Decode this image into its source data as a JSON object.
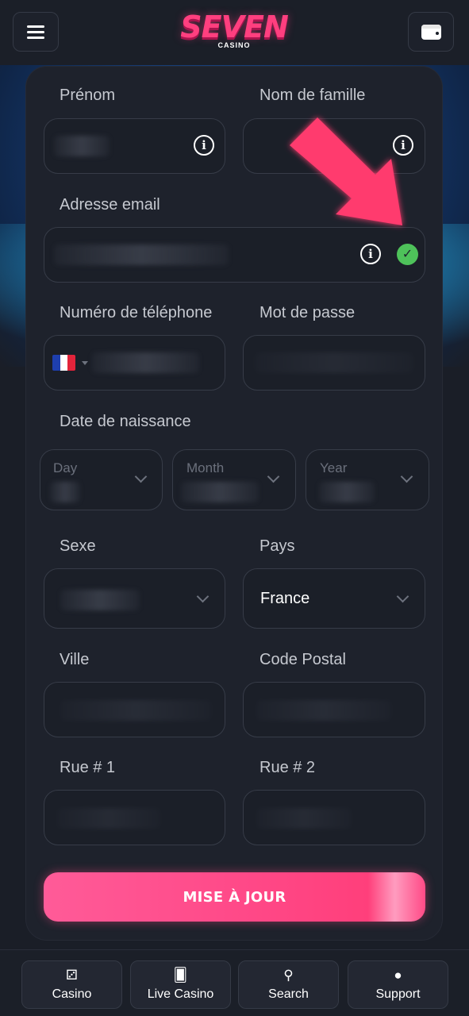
{
  "header": {
    "logo_text": "SEVEN",
    "logo_sub": "CASINO",
    "menu_icon": "hamburger-menu-icon",
    "wallet_icon": "wallet-icon"
  },
  "form": {
    "first_name": {
      "label": "Prénom",
      "icon": "info-icon"
    },
    "last_name": {
      "label": "Nom de famille",
      "icon": "info-icon"
    },
    "email": {
      "label": "Adresse email",
      "icon": "info-icon",
      "status_icon": "check-circle-icon"
    },
    "phone": {
      "label": "Numéro de téléphone",
      "country_flag": "france-flag-icon"
    },
    "password": {
      "label": "Mot de passe"
    },
    "birthdate": {
      "label": "Date de naissance",
      "day_label": "Day",
      "month_label": "Month",
      "year_label": "Year"
    },
    "gender": {
      "label": "Sexe"
    },
    "country": {
      "label": "Pays",
      "value": "France"
    },
    "city": {
      "label": "Ville"
    },
    "postal_code": {
      "label": "Code Postal"
    },
    "street1": {
      "label": "Rue # 1"
    },
    "street2": {
      "label": "Rue # 2"
    },
    "submit_label": "MISE À JOUR"
  },
  "bottom_nav": [
    {
      "label": "Casino",
      "icon": "dice-icon",
      "glyph": "⚂"
    },
    {
      "label": "Live Casino",
      "icon": "cards-icon",
      "glyph": "🂠"
    },
    {
      "label": "Search",
      "icon": "search-icon",
      "glyph": "⚲"
    },
    {
      "label": "Support",
      "icon": "chat-bubble-icon",
      "glyph": "●"
    }
  ],
  "colors": {
    "accent_pink": "#ff4887",
    "success_green": "#4ec25a",
    "background": "#1a1e27",
    "card": "#1e222c"
  }
}
